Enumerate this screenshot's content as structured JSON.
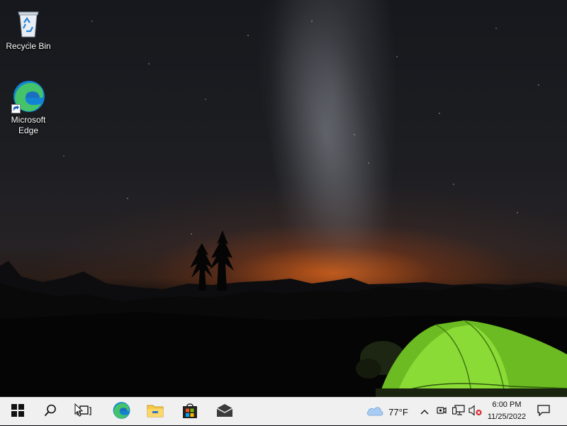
{
  "desktop": {
    "icons": [
      {
        "label": "Recycle Bin",
        "icon": "recycle-bin-icon"
      },
      {
        "label": "Microsoft Edge",
        "label_line1": "Microsoft",
        "label_line2": "Edge",
        "icon": "edge-icon"
      }
    ]
  },
  "taskbar": {
    "pinned": [
      {
        "name": "start",
        "icon": "windows-logo-icon"
      },
      {
        "name": "search",
        "icon": "search-icon"
      },
      {
        "name": "task-view",
        "icon": "task-view-icon"
      },
      {
        "name": "edge",
        "icon": "edge-icon"
      },
      {
        "name": "file-explorer",
        "icon": "folder-icon"
      },
      {
        "name": "store",
        "icon": "store-bag-icon"
      },
      {
        "name": "mail",
        "icon": "mail-icon"
      }
    ],
    "weather": {
      "temp": "77°F",
      "icon": "cloud-icon"
    },
    "tray": [
      "chevron-up-icon",
      "meet-now-icon",
      "network-icon",
      "volume-muted-icon"
    ],
    "clock": {
      "time": "6:00 PM",
      "date": "11/25/2022"
    },
    "notifications_icon": "notification-icon"
  },
  "colors": {
    "taskbar_bg": "#f0f0f0",
    "tent_green": "#7cd12a",
    "horizon_orange": "#d66018",
    "edge_blue": "#1283d4",
    "edge_green": "#44c36a",
    "folder_yellow": "#f7c948"
  }
}
